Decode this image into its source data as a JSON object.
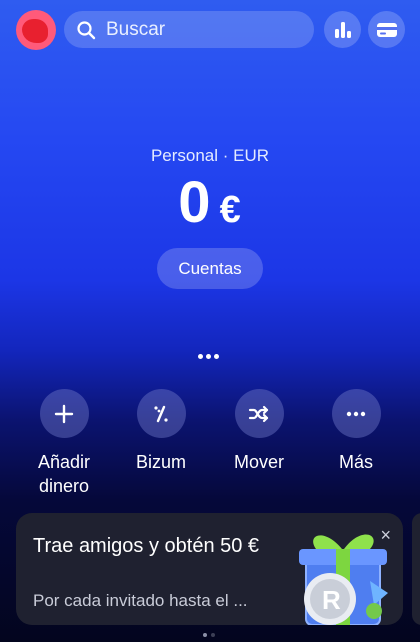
{
  "search": {
    "placeholder": "Buscar"
  },
  "balance": {
    "account_label": "Personal · EUR",
    "amount": "0",
    "currency": "€"
  },
  "accounts_button": "Cuentas",
  "actions": [
    {
      "label_line1": "Añadir",
      "label_line2": "dinero",
      "icon": "plus-icon"
    },
    {
      "label_line1": "Bizum",
      "label_line2": "",
      "icon": "bizum-icon"
    },
    {
      "label_line1": "Mover",
      "label_line2": "",
      "icon": "shuffle-icon"
    },
    {
      "label_line1": "Más",
      "label_line2": "",
      "icon": "more-horizontal-icon"
    }
  ],
  "promo": {
    "title": "Trae amigos y obtén 50 €",
    "subtitle": "Por cada invitado hasta el ...",
    "close_symbol": "×"
  },
  "colors": {
    "accent": "#2548f2",
    "card": "#1f2130"
  }
}
